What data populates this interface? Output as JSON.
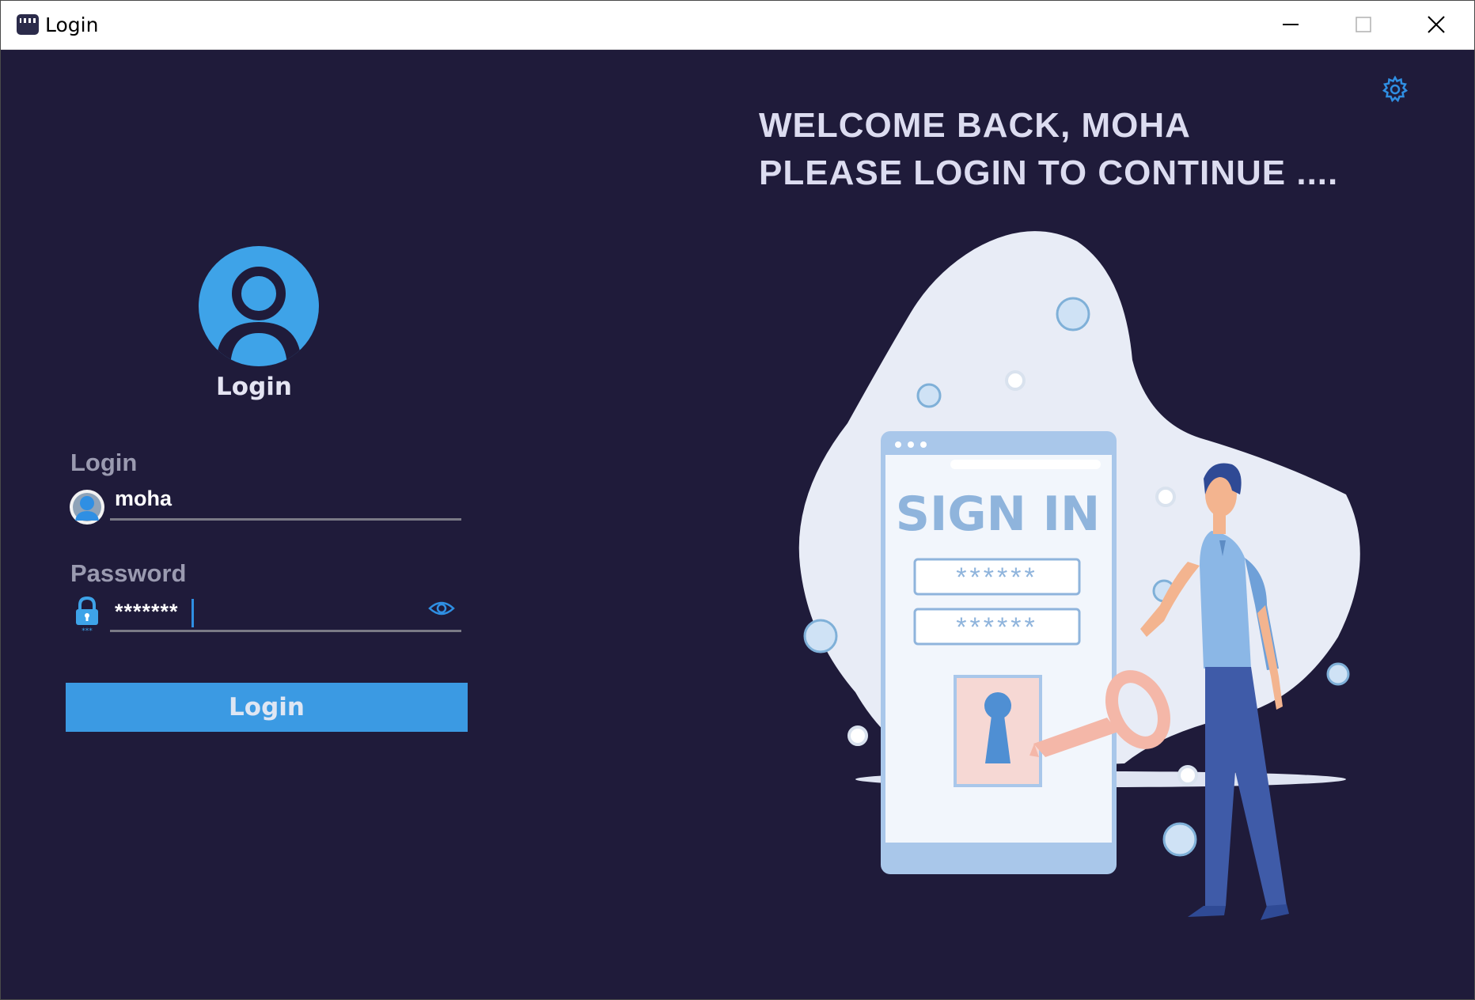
{
  "window": {
    "title": "Login",
    "controls": [
      "minimize",
      "maximize",
      "close"
    ]
  },
  "left_panel": {
    "avatar_caption": "Login",
    "login_label": "Login",
    "login_value": "moha",
    "password_label": "Password",
    "password_value": "*******",
    "login_button": "Login"
  },
  "right_panel": {
    "welcome_line1": "WELCOME BACK, MOHA",
    "welcome_line2": "PLEASE LOGIN TO CONTINUE ....",
    "illustration": {
      "heading": "SIGN IN",
      "field1": "******",
      "field2": "******"
    }
  },
  "colors": {
    "background": "#1f1b3a",
    "accent": "#3b9ae3",
    "input_line": "#7a7a86"
  }
}
